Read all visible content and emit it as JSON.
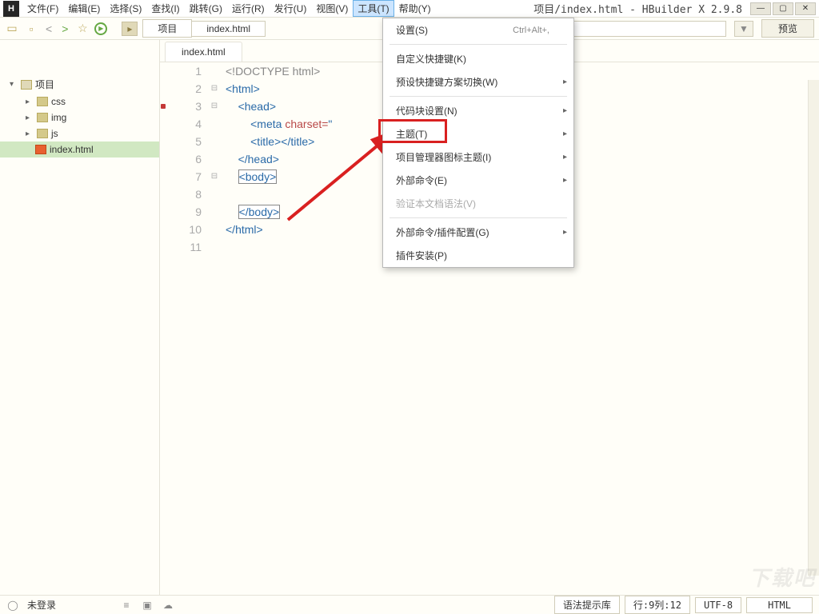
{
  "app": {
    "icon_label": "H",
    "title": "项目/index.html - HBuilder X 2.9.8"
  },
  "menubar": [
    "文件(F)",
    "编辑(E)",
    "选择(S)",
    "查找(I)",
    "跳转(G)",
    "运行(R)",
    "发行(U)",
    "视图(V)",
    "工具(T)",
    "帮助(Y)"
  ],
  "menubar_active_index": 8,
  "win": {
    "min": "—",
    "max": "▢",
    "close": "✕"
  },
  "toolbar": {
    "breadcrumbs": [
      "项目",
      "index.html"
    ],
    "preview_label": "预览"
  },
  "sidebar": {
    "root": "项目",
    "items": [
      {
        "label": "css"
      },
      {
        "label": "img"
      },
      {
        "label": "js"
      }
    ],
    "file": "index.html"
  },
  "tab": {
    "label": "index.html"
  },
  "code_lines": [
    "<!DOCTYPE html>",
    "<html>",
    "    <head>",
    "        <meta charset=\"",
    "        <title></title>",
    "    </head>",
    "    <body>",
    "",
    "    </body>",
    "</html>",
    ""
  ],
  "dropdown": {
    "items": [
      {
        "label": "设置(S)",
        "shortcut": "Ctrl+Alt+,"
      },
      {
        "sep": true
      },
      {
        "label": "自定义快捷键(K)"
      },
      {
        "label": "预设快捷键方案切换(W)",
        "sub": true
      },
      {
        "sep": true
      },
      {
        "label": "代码块设置(N)",
        "sub": true
      },
      {
        "label": "主题(T)",
        "sub": true,
        "highlight": true
      },
      {
        "label": "项目管理器图标主题(I)",
        "sub": true
      },
      {
        "label": "外部命令(E)",
        "sub": true
      },
      {
        "label": "验证本文档语法(V)",
        "disabled": true
      },
      {
        "sep": true
      },
      {
        "label": "外部命令/插件配置(G)",
        "sub": true
      },
      {
        "label": "插件安装(P)"
      }
    ]
  },
  "status": {
    "login": "未登录",
    "hintlib": "语法提示库",
    "pos": "行:9列:12",
    "encoding": "UTF-8",
    "lang": "HTML"
  },
  "watermark": "下载吧"
}
